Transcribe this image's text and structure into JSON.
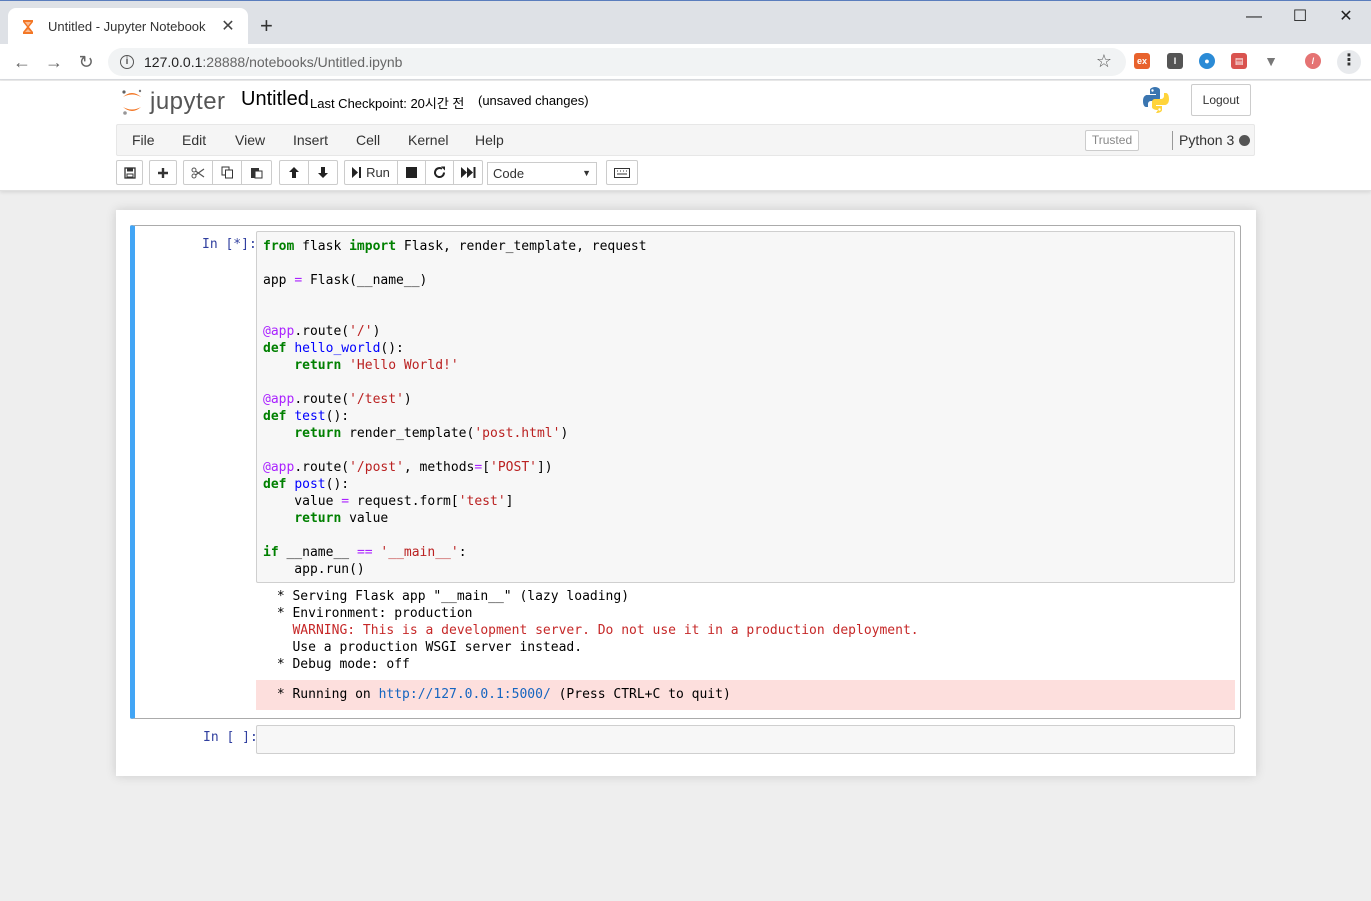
{
  "browser": {
    "tab_title": "Untitled - Jupyter Notebook",
    "url_host": "127.0.0.1",
    "url_path": ":28888/notebooks/Untitled.ipynb"
  },
  "header": {
    "logo_text": "jupyter",
    "notebook_name": "Untitled",
    "checkpoint": "Last Checkpoint: 20시간 전",
    "autosave_status": "(unsaved changes)",
    "logout_label": "Logout"
  },
  "menubar": {
    "items": [
      "File",
      "Edit",
      "View",
      "Insert",
      "Cell",
      "Kernel",
      "Help"
    ],
    "trusted_label": "Trusted",
    "kernel_name": "Python 3"
  },
  "toolbar": {
    "run_label": "Run",
    "cell_type": "Code"
  },
  "cells": [
    {
      "prompt": "In [*]:",
      "code_lines": [
        "from flask import Flask, render_template, request",
        "",
        "app = Flask(__name__)",
        "",
        "",
        "@app.route('/')",
        "def hello_world():",
        "    return 'Hello World!'",
        "",
        "@app.route('/test')",
        "def test():",
        "    return render_template('post.html')",
        "",
        "@app.route('/post', methods=['POST'])",
        "def post():",
        "    value = request.form['test']",
        "    return value",
        "",
        "if __name__ == '__main__':",
        "    app.run()"
      ],
      "output_lines": [
        " * Serving Flask app \"__main__\" (lazy loading)",
        " * Environment: production",
        "   WARNING: This is a development server. Do not use it in a production deployment.",
        "   Use a production WSGI server instead.",
        " * Debug mode: off"
      ],
      "stderr_prefix": " * Running on ",
      "stderr_link": "http://127.0.0.1:5000/",
      "stderr_suffix": " (Press CTRL+C to quit)"
    },
    {
      "prompt": "In [ ]:"
    }
  ]
}
